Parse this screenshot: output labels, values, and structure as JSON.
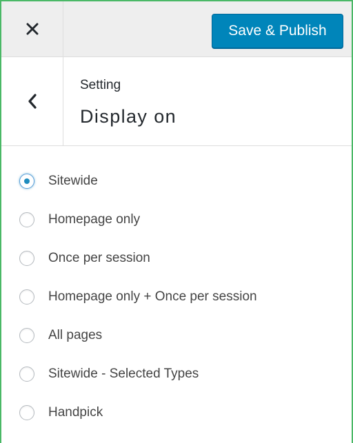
{
  "topbar": {
    "close_icon": "close-icon",
    "publish_label": "Save & Publish",
    "publish_color": "#0085ba"
  },
  "section": {
    "back_icon": "chevron-left-icon",
    "breadcrumb": "Setting",
    "title": "Display on"
  },
  "display_options": {
    "selected": "Sitewide",
    "items": [
      {
        "label": "Sitewide",
        "checked": true
      },
      {
        "label": "Homepage only",
        "checked": false
      },
      {
        "label": "Once per session",
        "checked": false
      },
      {
        "label": "Homepage only + Once per session",
        "checked": false
      },
      {
        "label": "All pages",
        "checked": false
      },
      {
        "label": "Sitewide - Selected Types",
        "checked": false
      },
      {
        "label": "Handpick",
        "checked": false
      }
    ]
  },
  "colors": {
    "frame_border": "#4ab866",
    "topbar_bg": "#eeeeee",
    "radio_checked": "#1e8cbe"
  }
}
